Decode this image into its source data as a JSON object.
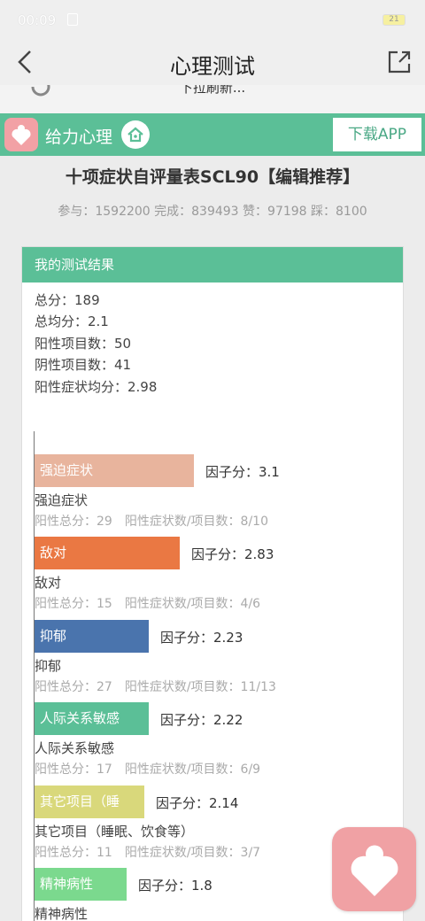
{
  "status": {
    "time": "00:09",
    "battery": "21"
  },
  "navbar": {
    "title": "心理测试"
  },
  "refresh": {
    "label": "下拉刷新..."
  },
  "brand": {
    "name": "给力心理",
    "download_label": "下载APP"
  },
  "test": {
    "title": "十项症状自评量表SCL90【编辑推荐】",
    "stats": "参与：1592200 完成：839493 赞：97198 踩：8100"
  },
  "result": {
    "header": "我的测试结果",
    "summary": [
      "总分：189",
      "总均分：2.1",
      "阳性项目数：50",
      "阴性项目数：41",
      "阳性症状均分：2.98"
    ]
  },
  "factors": [
    {
      "bar_label": "强迫症状",
      "value": 3.1,
      "score_label": "因子分：3.1",
      "name": "强迫症状",
      "positive_total": "阳性总分：29",
      "ratio": "阳性症状数/项目数：8/10",
      "color": "#e8b49d"
    },
    {
      "bar_label": "敌对",
      "value": 2.83,
      "score_label": "因子分：2.83",
      "name": "敌对",
      "positive_total": "阳性总分：15",
      "ratio": "阳性症状数/项目数：4/6",
      "color": "#ea7843"
    },
    {
      "bar_label": "抑郁",
      "value": 2.23,
      "score_label": "因子分：2.23",
      "name": "抑郁",
      "positive_total": "阳性总分：27",
      "ratio": "阳性症状数/项目数：11/13",
      "color": "#4a74ad"
    },
    {
      "bar_label": "人际关系敏感",
      "value": 2.22,
      "score_label": "因子分：2.22",
      "name": "人际关系敏感",
      "positive_total": "阳性总分：17",
      "ratio": "阳性症状数/项目数：6/9",
      "color": "#5bbf97"
    },
    {
      "bar_label": "其它项目（睡",
      "value": 2.14,
      "score_label": "因子分：2.14",
      "name": "其它项目（睡眠、饮食等）",
      "positive_total": "阳性总分：11",
      "ratio": "阳性症状数/项目数：3/7",
      "color": "#d9d87b"
    },
    {
      "bar_label": "精神病性",
      "value": 1.8,
      "score_label": "因子分：1.8",
      "name": "精神病性",
      "positive_total": "",
      "ratio": "",
      "color": "#7bd98e"
    }
  ]
}
